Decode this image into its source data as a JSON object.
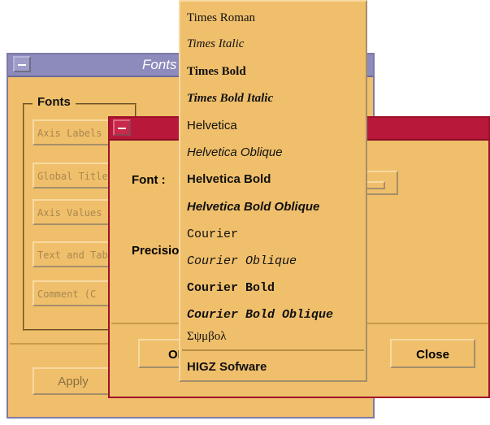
{
  "back_window": {
    "title": "Fonts",
    "group_label": "Fonts",
    "buttons": [
      "Axis Labels",
      "Global Title",
      "Axis Values",
      "Text and Tables",
      "Comment (C"
    ],
    "apply_label": "Apply"
  },
  "front_dialog": {
    "font_label": "Font :",
    "precision_label": "Precision :",
    "ok_label": "OK",
    "close_label": "Close"
  },
  "font_menu": {
    "items": [
      "Times Roman",
      "Times Italic",
      "Times Bold",
      "Times Bold Italic",
      "Helvetica",
      "Helvetica Oblique",
      "Helvetica Bold",
      "Helvetica Bold Oblique",
      "Courier",
      "Courier Oblique",
      "Courier Bold",
      "Courier Bold Oblique",
      "Σψμβολ"
    ],
    "footer_item": "HIGZ Sofware"
  },
  "colors": {
    "panel": "#f0bf6b",
    "back_titlebar": "#8d8bbc",
    "front_titlebar": "#b8183a"
  }
}
